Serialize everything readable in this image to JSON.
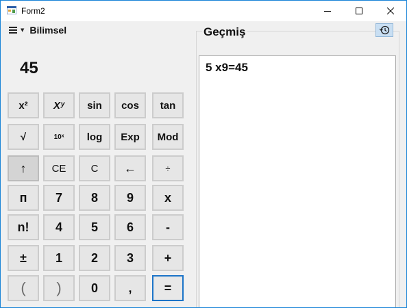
{
  "window": {
    "title": "Form2",
    "minimize": "—",
    "maximize": "☐",
    "close": "✕"
  },
  "menu": {
    "mode_label": "Bilimsel",
    "dropdown_arrow": "▼"
  },
  "display": {
    "value": "45"
  },
  "keys": {
    "square": "x²",
    "power": "Xʸ",
    "sin": "sin",
    "cos": "cos",
    "tan": "tan",
    "sqrt": "√",
    "ten_power": "10ˣ",
    "log": "log",
    "exp": "Exp",
    "mod": "Mod",
    "shift": "↑",
    "ce": "CE",
    "c": "C",
    "backspace": "←",
    "divide": "÷",
    "pi": "п",
    "seven": "7",
    "eight": "8",
    "nine": "9",
    "multiply": "x",
    "factorial": "n!",
    "four": "4",
    "five": "5",
    "six": "6",
    "minus": "-",
    "plus_minus": "±",
    "one": "1",
    "two": "2",
    "three": "3",
    "plus": "+",
    "open_paren": "(",
    "close_paren": ")",
    "zero": "0",
    "comma": ",",
    "equals": "="
  },
  "history": {
    "title": "Geçmiş",
    "entries": [
      "5 x9=45"
    ]
  },
  "colors": {
    "accent": "#1c74c8",
    "window_border": "#1883d7",
    "history_button": "#c9dff3"
  }
}
